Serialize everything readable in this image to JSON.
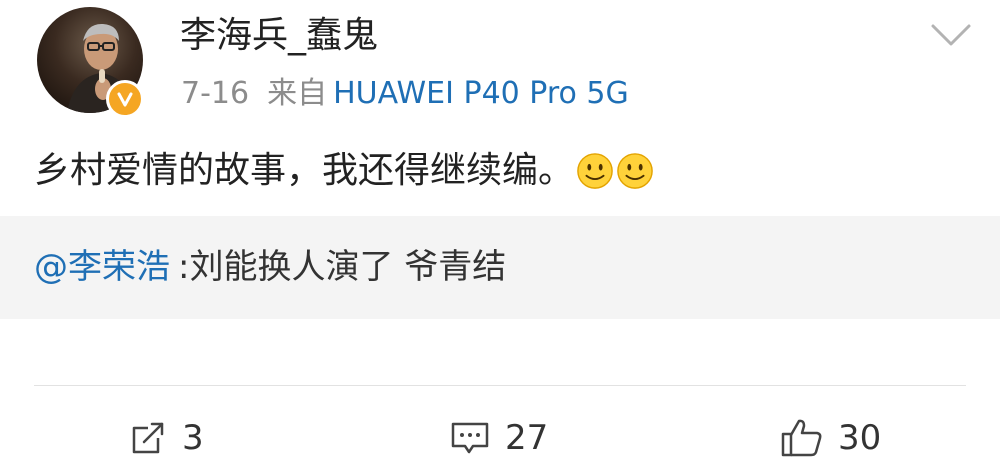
{
  "post": {
    "author": "李海兵_蠢鬼",
    "date": "7-16",
    "from_label": "来自",
    "device": "HUAWEI P40 Pro 5G",
    "content": "乡村爱情的故事，我还得继续编。",
    "emojis": [
      "smile-emoji",
      "smile-emoji"
    ],
    "verified_badge": "V"
  },
  "quote": {
    "mention": "@李荣浩",
    "text": ":刘能换人演了 爷青结"
  },
  "actions": {
    "repost_count": "3",
    "comment_count": "27",
    "like_count": "30"
  },
  "colors": {
    "link": "#1f6fb5",
    "verified": "#f5a623",
    "quote_bg": "#f4f4f4",
    "meta_gray": "#8c8c8c"
  }
}
